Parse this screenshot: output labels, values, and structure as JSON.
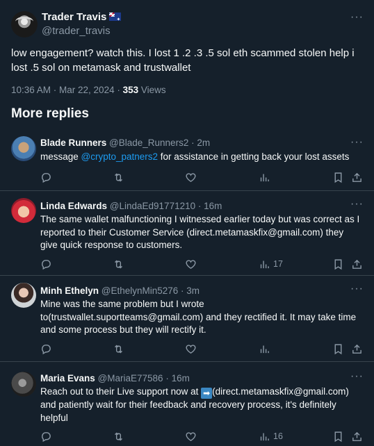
{
  "main_tweet": {
    "author_name": "Trader Travis",
    "flag_icon": "australia-flag",
    "author_handle": "@trader_travis",
    "text": "low engagement? watch this. I lost 1 .2 .3 .5 sol eth scammed stolen help i lost .5 sol on metamask and trustwallet",
    "time": "10:36 AM · Mar 22, 2024 · ",
    "views_count": "353",
    "views_label": " Views"
  },
  "section_title": "More replies",
  "replies": [
    {
      "name": "Blade Runners",
      "handle": "@Blade_Runners2 · 2m",
      "text_before": "message ",
      "mention": "@crypto_patners2",
      "text_after": " for assistance in getting back your lost assets",
      "views": ""
    },
    {
      "name": "Linda Edwards",
      "handle": "@LindaEd91771210 · 16m",
      "text": "The same wallet malfunctioning I witnessed earlier today but was correct as I reported to their Customer Service (direct.metamaskfix@gmail.com) they give quick response to customers.",
      "views": "17"
    },
    {
      "name": "Minh Ethelyn",
      "handle": "@EthelynMin5276 · 3m",
      "text": "Mine was the same problem but I wrote to(trustwallet.suportteams@gmail.com) and they rectified it. It may take time and some process but they will rectify it.",
      "views": ""
    },
    {
      "name": "Maria Evans",
      "handle": "@MariaE77586 · 16m",
      "text_before": "Reach out to their Live support now at ",
      "emoji": "➡",
      "text_after": "(direct.metamaskfix@gmail.com) and patiently wait for their feedback and recovery process, it's definitely helpful",
      "views": "16"
    }
  ],
  "icons": {
    "more": "more-icon",
    "reply": "reply-icon",
    "retweet": "retweet-icon",
    "like": "like-icon",
    "views": "views-icon",
    "bookmark": "bookmark-icon",
    "share": "share-icon"
  },
  "colors": {
    "background": "#15202b",
    "text": "#f7f9f9",
    "secondary": "#8b98a5",
    "link": "#1d9bf0",
    "divider": "#38444d"
  }
}
